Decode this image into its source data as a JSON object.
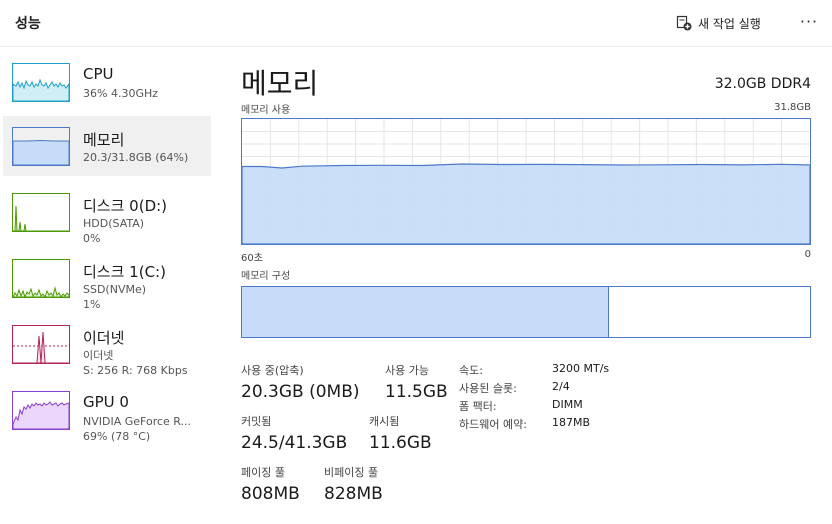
{
  "header": {
    "title": "성능",
    "new_task_label": "새 작업 실행",
    "more_label": "···"
  },
  "sidebar": {
    "items": [
      {
        "name": "CPU",
        "line2": "36% 4.30GHz",
        "line3": "",
        "color": "#1fa0c8",
        "fill": "#cfeef6"
      },
      {
        "name": "메모리",
        "line2": "20.3/31.8GB (64%)",
        "line3": "",
        "color": "#4d7ac8",
        "fill": "#c6dcf8"
      },
      {
        "name": "디스크 0(D:)",
        "line2": "HDD(SATA)",
        "line3": "0%",
        "color": "#4e9a06",
        "fill": "#e4f2d6"
      },
      {
        "name": "디스크 1(C:)",
        "line2": "SSD(NVMe)",
        "line3": "1%",
        "color": "#4e9a06",
        "fill": "#e4f2d6"
      },
      {
        "name": "이더넷",
        "line2": "이더넷",
        "line3": "S: 256  R: 768 Kbps",
        "color": "#b0245a",
        "fill": "#fbe4ec"
      },
      {
        "name": "GPU 0",
        "line2": "NVIDIA GeForce R...",
        "line3": "69% (78 °C)",
        "color": "#8a3fd0",
        "fill": "#ead7fb"
      }
    ]
  },
  "main": {
    "title": "메모리",
    "spec": "32.0GB DDR4",
    "usage_label": "메모리 사용",
    "usage_max": "31.8GB",
    "x_left": "60초",
    "x_right": "0",
    "composition_label": "메모리 구성",
    "usage_fraction": 0.64,
    "composition": {
      "in_use_fraction": 0.64,
      "modified_fraction": 0.005
    }
  },
  "stats": {
    "in_use_label": "사용 중(압축)",
    "in_use_value": "20.3GB (0MB)",
    "available_label": "사용 가능",
    "available_value": "11.5GB",
    "committed_label": "커밋됨",
    "committed_value": "24.5/41.3GB",
    "cached_label": "캐시됨",
    "cached_value": "11.6GB",
    "paged_label": "페이징 풀",
    "paged_value": "808MB",
    "nonpaged_label": "비페이징 풀",
    "nonpaged_value": "828MB"
  },
  "properties": [
    {
      "label": "속도:",
      "value": "3200 MT/s"
    },
    {
      "label": "사용된 슬롯:",
      "value": "2/4"
    },
    {
      "label": "폼 팩터:",
      "value": "DIMM"
    },
    {
      "label": "하드웨어 예약:",
      "value": "187MB"
    }
  ],
  "colors": {
    "accent": "#4d7ac8",
    "memory_fill": "#c6dcf8",
    "grid": "#e6e6e6"
  }
}
